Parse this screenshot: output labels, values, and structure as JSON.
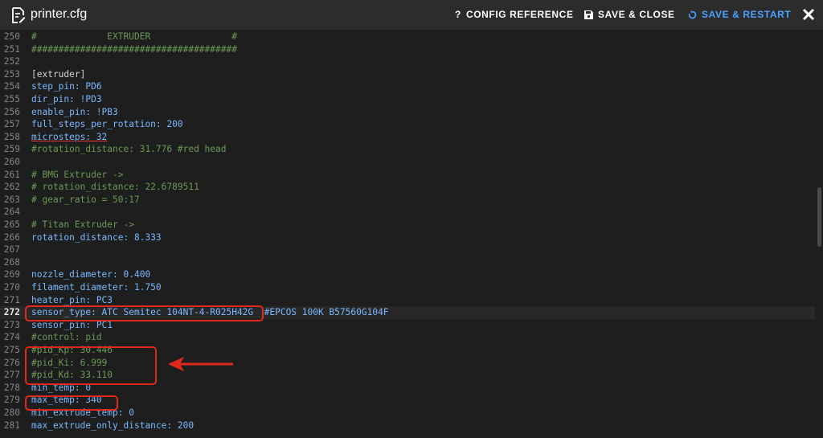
{
  "header": {
    "title": "printer.cfg",
    "config_reference": "CONFIG REFERENCE",
    "save_close": "SAVE & CLOSE",
    "save_restart": "SAVE & RESTART",
    "icons": {
      "file": "file-edit-icon",
      "help": "question-icon",
      "save": "floppy-disk-icon",
      "restart": "restart-icon",
      "close": "close-icon"
    },
    "colors": {
      "accent": "#4aa3ff",
      "annotation": "#e0291a"
    }
  },
  "editor": {
    "lines": [
      {
        "n": "250",
        "t": "#             EXTRUDER               #"
      },
      {
        "n": "251",
        "t": "######################################"
      },
      {
        "n": "252",
        "t": ""
      },
      {
        "n": "253",
        "t": "[extruder]"
      },
      {
        "n": "254",
        "t": "step_pin: PD6"
      },
      {
        "n": "255",
        "t": "dir_pin: !PD3"
      },
      {
        "n": "256",
        "t": "enable_pin: !PB3"
      },
      {
        "n": "257",
        "t": "full_steps_per_rotation: 200"
      },
      {
        "n": "258",
        "t": "microsteps: 32"
      },
      {
        "n": "259",
        "t": "#rotation_distance: 31.776 #red head"
      },
      {
        "n": "260",
        "t": ""
      },
      {
        "n": "261",
        "t": "# BMG Extruder ->"
      },
      {
        "n": "262",
        "t": "# rotation_distance: 22.6789511"
      },
      {
        "n": "263",
        "t": "# gear_ratio = 50:17"
      },
      {
        "n": "264",
        "t": ""
      },
      {
        "n": "265",
        "t": "# Titan Extruder ->"
      },
      {
        "n": "266",
        "t": "rotation_distance: 8.333"
      },
      {
        "n": "267",
        "t": ""
      },
      {
        "n": "268",
        "t": ""
      },
      {
        "n": "269",
        "t": "nozzle_diameter: 0.400"
      },
      {
        "n": "270",
        "t": "filament_diameter: 1.750"
      },
      {
        "n": "271",
        "t": "heater_pin: PC3"
      },
      {
        "n": "272",
        "t": "sensor_type: ATC Semitec 104NT-4-R025H42G  #EPCOS 100K B57560G104F"
      },
      {
        "n": "273",
        "t": "sensor_pin: PC1"
      },
      {
        "n": "274",
        "t": "#control: pid"
      },
      {
        "n": "275",
        "t": "#pid_Kp: 30.446"
      },
      {
        "n": "276",
        "t": "#pid_Ki: 6.999"
      },
      {
        "n": "277",
        "t": "#pid_Kd: 33.110"
      },
      {
        "n": "278",
        "t": "min_temp: 0"
      },
      {
        "n": "279",
        "t": "max_temp: 340"
      },
      {
        "n": "280",
        "t": "min_extrude_temp: 0"
      },
      {
        "n": "281",
        "t": "max_extrude_only_distance: 200"
      }
    ],
    "active_line": "272"
  }
}
